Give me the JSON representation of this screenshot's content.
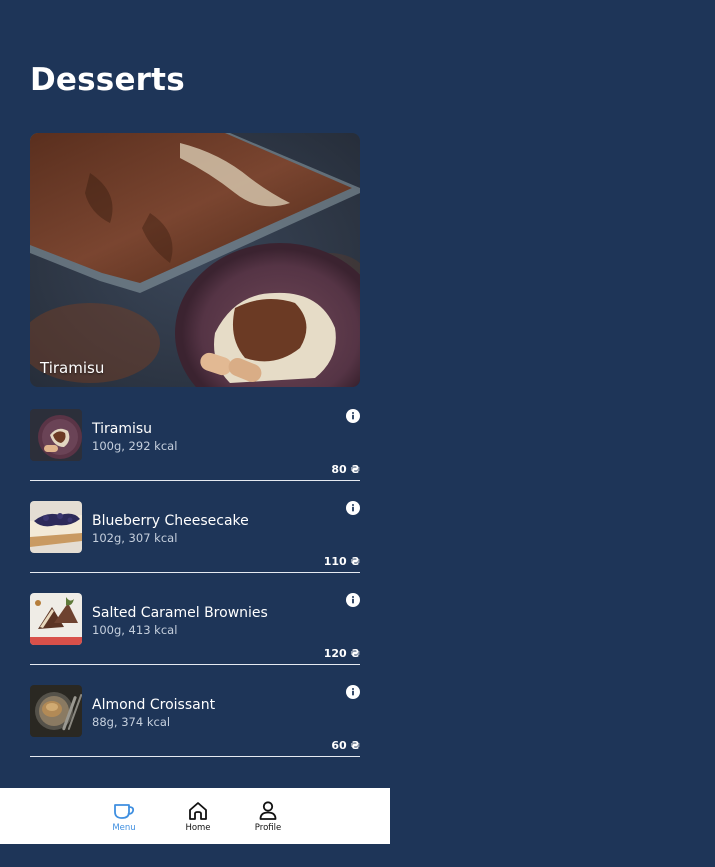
{
  "page": {
    "title": "Desserts"
  },
  "featured": {
    "caption": "Tiramisu"
  },
  "items": [
    {
      "name": "Tiramisu",
      "meta": "100g, 292 kcal",
      "price": "80 ₴"
    },
    {
      "name": "Blueberry Cheesecake",
      "meta": "102g, 307 kcal",
      "price": "110 ₴"
    },
    {
      "name": "Salted Caramel Brownies",
      "meta": "100g, 413 kcal",
      "price": "120 ₴"
    },
    {
      "name": "Almond Croissant",
      "meta": "88g, 374 kcal",
      "price": "60 ₴"
    }
  ],
  "nav": {
    "menu_label": "Menu",
    "home_label": "Home",
    "profile_label": "Profile",
    "active": "Menu"
  },
  "colors": {
    "background": "#1e3558",
    "nav_background": "#ffffff",
    "accent": "#3f8fe0",
    "divider": "#e6ebf2"
  },
  "icons": {
    "info": "info-icon",
    "menu": "coffee-cup-icon",
    "home": "home-icon",
    "profile": "user-icon"
  }
}
